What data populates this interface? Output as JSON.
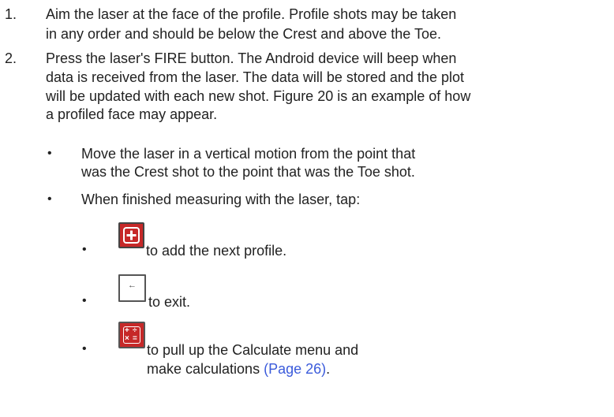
{
  "steps": [
    {
      "number": "1.",
      "lines": [
        "Aim the laser at the face of the profile. Profile shots may be taken",
        "in any order and should be below the Crest and above the Toe."
      ]
    },
    {
      "number": "2.",
      "lines": [
        "Press the laser's FIRE button. The Android device will beep when",
        "data is received from the laser. The data will be stored and the plot",
        "will be updated with each new shot. Figure 20 is an example of how",
        "a profiled face may appear."
      ]
    }
  ],
  "bullets": [
    {
      "symbol": "•",
      "lines": [
        "Move the laser in a vertical motion from the point that",
        "was the Crest shot to the point that was the Toe shot."
      ]
    },
    {
      "symbol": "•",
      "lines": [
        "When finished measuring with the laser, tap:"
      ]
    }
  ],
  "actions": [
    {
      "symbol": "•",
      "icon": "add-icon",
      "text": "to add the next profile."
    },
    {
      "symbol": "•",
      "icon": "back-arrow-icon",
      "icon_glyph": "←",
      "text": "to exit."
    },
    {
      "symbol": "•",
      "icon": "calculator-icon",
      "calc_glyphs": [
        "+",
        "÷",
        "×",
        "="
      ],
      "text": "to pull up the Calculate menu and",
      "text2": "make calculations ",
      "link": "(Page 26)",
      "end": "."
    }
  ],
  "colors": {
    "icon_red": "#c62828",
    "link": "#3b5bdb"
  }
}
